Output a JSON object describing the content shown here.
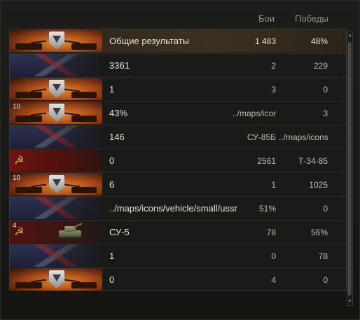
{
  "header": {
    "battles": "Бои",
    "wins": "Победы"
  },
  "rows": [
    {
      "flag": "wot",
      "tier": "",
      "vehicle": false,
      "name": "Общие результаты",
      "battles": "1 483",
      "wins": "48%"
    },
    {
      "flag": "uk",
      "tier": "",
      "vehicle": false,
      "name": "3361",
      "battles": "2",
      "wins": "229"
    },
    {
      "flag": "wot",
      "tier": "",
      "vehicle": false,
      "name": "1",
      "battles": "3",
      "wins": "0"
    },
    {
      "flag": "wot",
      "tier": "10",
      "vehicle": false,
      "name": "43%",
      "battles": "../maps/icor",
      "wins": "3"
    },
    {
      "flag": "uk",
      "tier": "",
      "vehicle": false,
      "name": "146",
      "battles": "СУ-85Б",
      "wins": "../maps/icons/"
    },
    {
      "flag": "ussr",
      "tier": "",
      "vehicle": false,
      "name": "0",
      "battles": "2561",
      "wins": "Т-34-85"
    },
    {
      "flag": "wot",
      "tier": "10",
      "vehicle": false,
      "name": "6",
      "battles": "1",
      "wins": "1025"
    },
    {
      "flag": "uk",
      "tier": "",
      "vehicle": false,
      "name": "../maps/icons/vehicle/small/ussr",
      "battles": "51%",
      "wins": "0"
    },
    {
      "flag": "ussr-tank",
      "tier": "4",
      "vehicle": true,
      "name": "СУ-5",
      "battles": "78",
      "wins": "56%"
    },
    {
      "flag": "uk",
      "tier": "",
      "vehicle": false,
      "name": "1",
      "battles": "0",
      "wins": "78"
    },
    {
      "flag": "wot",
      "tier": "",
      "vehicle": false,
      "name": "0",
      "battles": "4",
      "wins": "0"
    }
  ],
  "icons": {
    "ussr_emblem": "☭",
    "wot_emblem": "wot-shield-icon",
    "vehicle": "tank-icon",
    "scroll_up": "▲",
    "scroll_down": "▼"
  }
}
